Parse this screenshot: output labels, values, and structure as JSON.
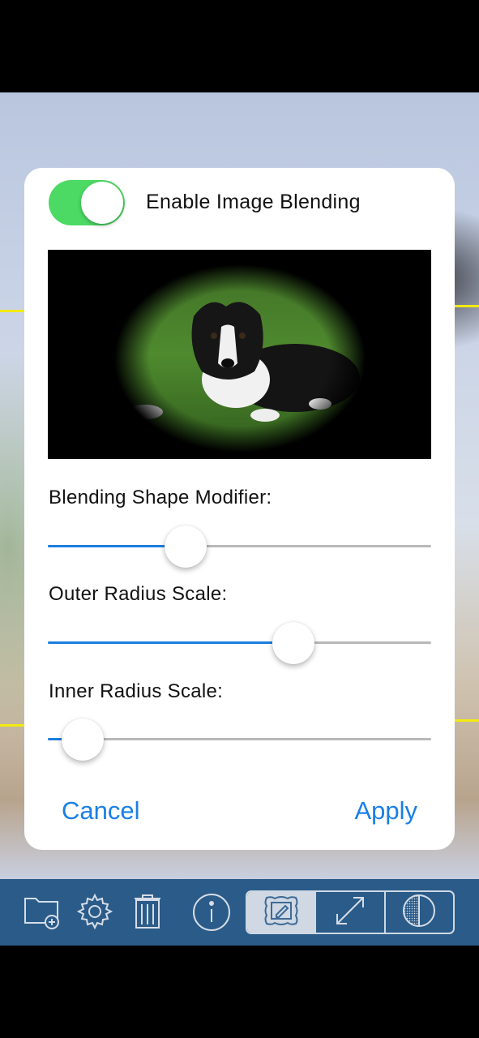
{
  "dialog": {
    "toggle_label": "Enable Image Blending",
    "toggle_on": true,
    "sliders": [
      {
        "label": "Blending Shape Modifier:",
        "value": 0.36
      },
      {
        "label": "Outer Radius Scale:",
        "value": 0.64
      },
      {
        "label": "Inner Radius Scale:",
        "value": 0.09
      }
    ],
    "cancel_label": "Cancel",
    "apply_label": "Apply"
  },
  "toolbar": {
    "icons": [
      "add-folder-icon",
      "gear-icon",
      "trash-icon",
      "info-icon"
    ],
    "segments": [
      "frame-edit-icon",
      "resize-arrows-icon",
      "contrast-circle-icon"
    ],
    "active_segment": 0
  },
  "colors": {
    "accent": "#1a7fe6",
    "toggle_on": "#4cd964",
    "toolbar_bg": "#2a5b89",
    "highlight_frame": "#f2ea10"
  }
}
